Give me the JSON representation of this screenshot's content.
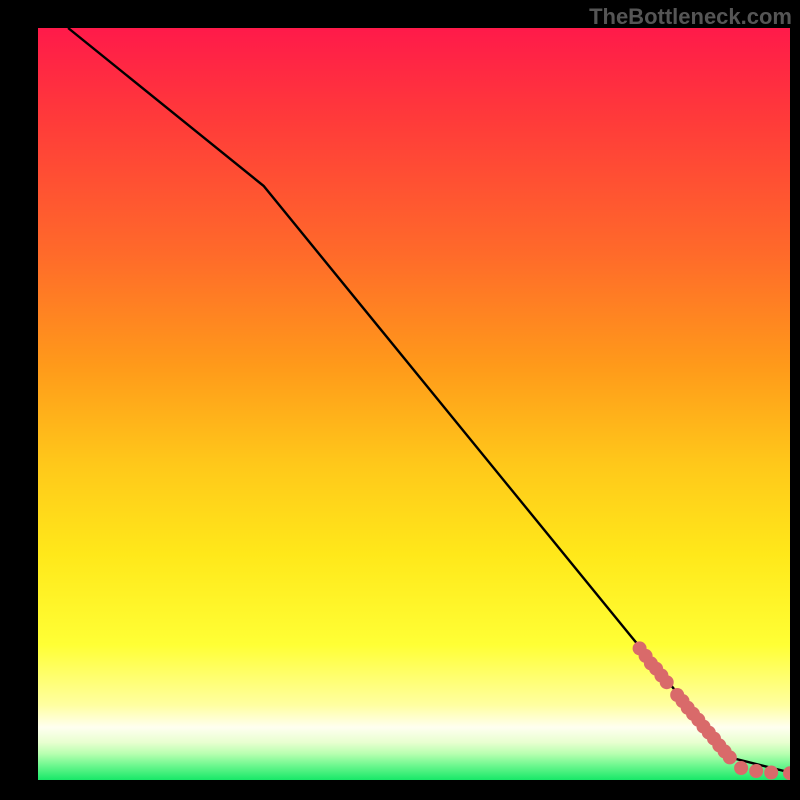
{
  "watermark": "TheBottleneck.com",
  "chart_data": {
    "type": "line",
    "xlim": [
      0,
      100
    ],
    "ylim": [
      0,
      100
    ],
    "title": "",
    "xlabel": "",
    "ylabel": "",
    "curve": [
      {
        "x": 4,
        "y": 100
      },
      {
        "x": 30,
        "y": 79
      },
      {
        "x": 92,
        "y": 3
      },
      {
        "x": 100,
        "y": 1
      }
    ],
    "points": [
      {
        "x": 80.0,
        "y": 17.5
      },
      {
        "x": 80.8,
        "y": 16.5
      },
      {
        "x": 81.5,
        "y": 15.5
      },
      {
        "x": 82.2,
        "y": 14.8
      },
      {
        "x": 82.9,
        "y": 13.9
      },
      {
        "x": 83.6,
        "y": 13.0
      },
      {
        "x": 85.0,
        "y": 11.3
      },
      {
        "x": 85.7,
        "y": 10.5
      },
      {
        "x": 86.4,
        "y": 9.6
      },
      {
        "x": 87.1,
        "y": 8.8
      },
      {
        "x": 87.8,
        "y": 8.0
      },
      {
        "x": 88.5,
        "y": 7.1
      },
      {
        "x": 89.2,
        "y": 6.3
      },
      {
        "x": 89.9,
        "y": 5.5
      },
      {
        "x": 90.6,
        "y": 4.6
      },
      {
        "x": 91.3,
        "y": 3.8
      },
      {
        "x": 92.0,
        "y": 3.0
      },
      {
        "x": 93.5,
        "y": 1.6
      },
      {
        "x": 95.5,
        "y": 1.2
      },
      {
        "x": 97.5,
        "y": 1.0
      },
      {
        "x": 100.0,
        "y": 0.9
      }
    ],
    "point_color": "#d96a6a",
    "point_radius": 7,
    "line_color": "#000000",
    "line_width": 2.4
  }
}
